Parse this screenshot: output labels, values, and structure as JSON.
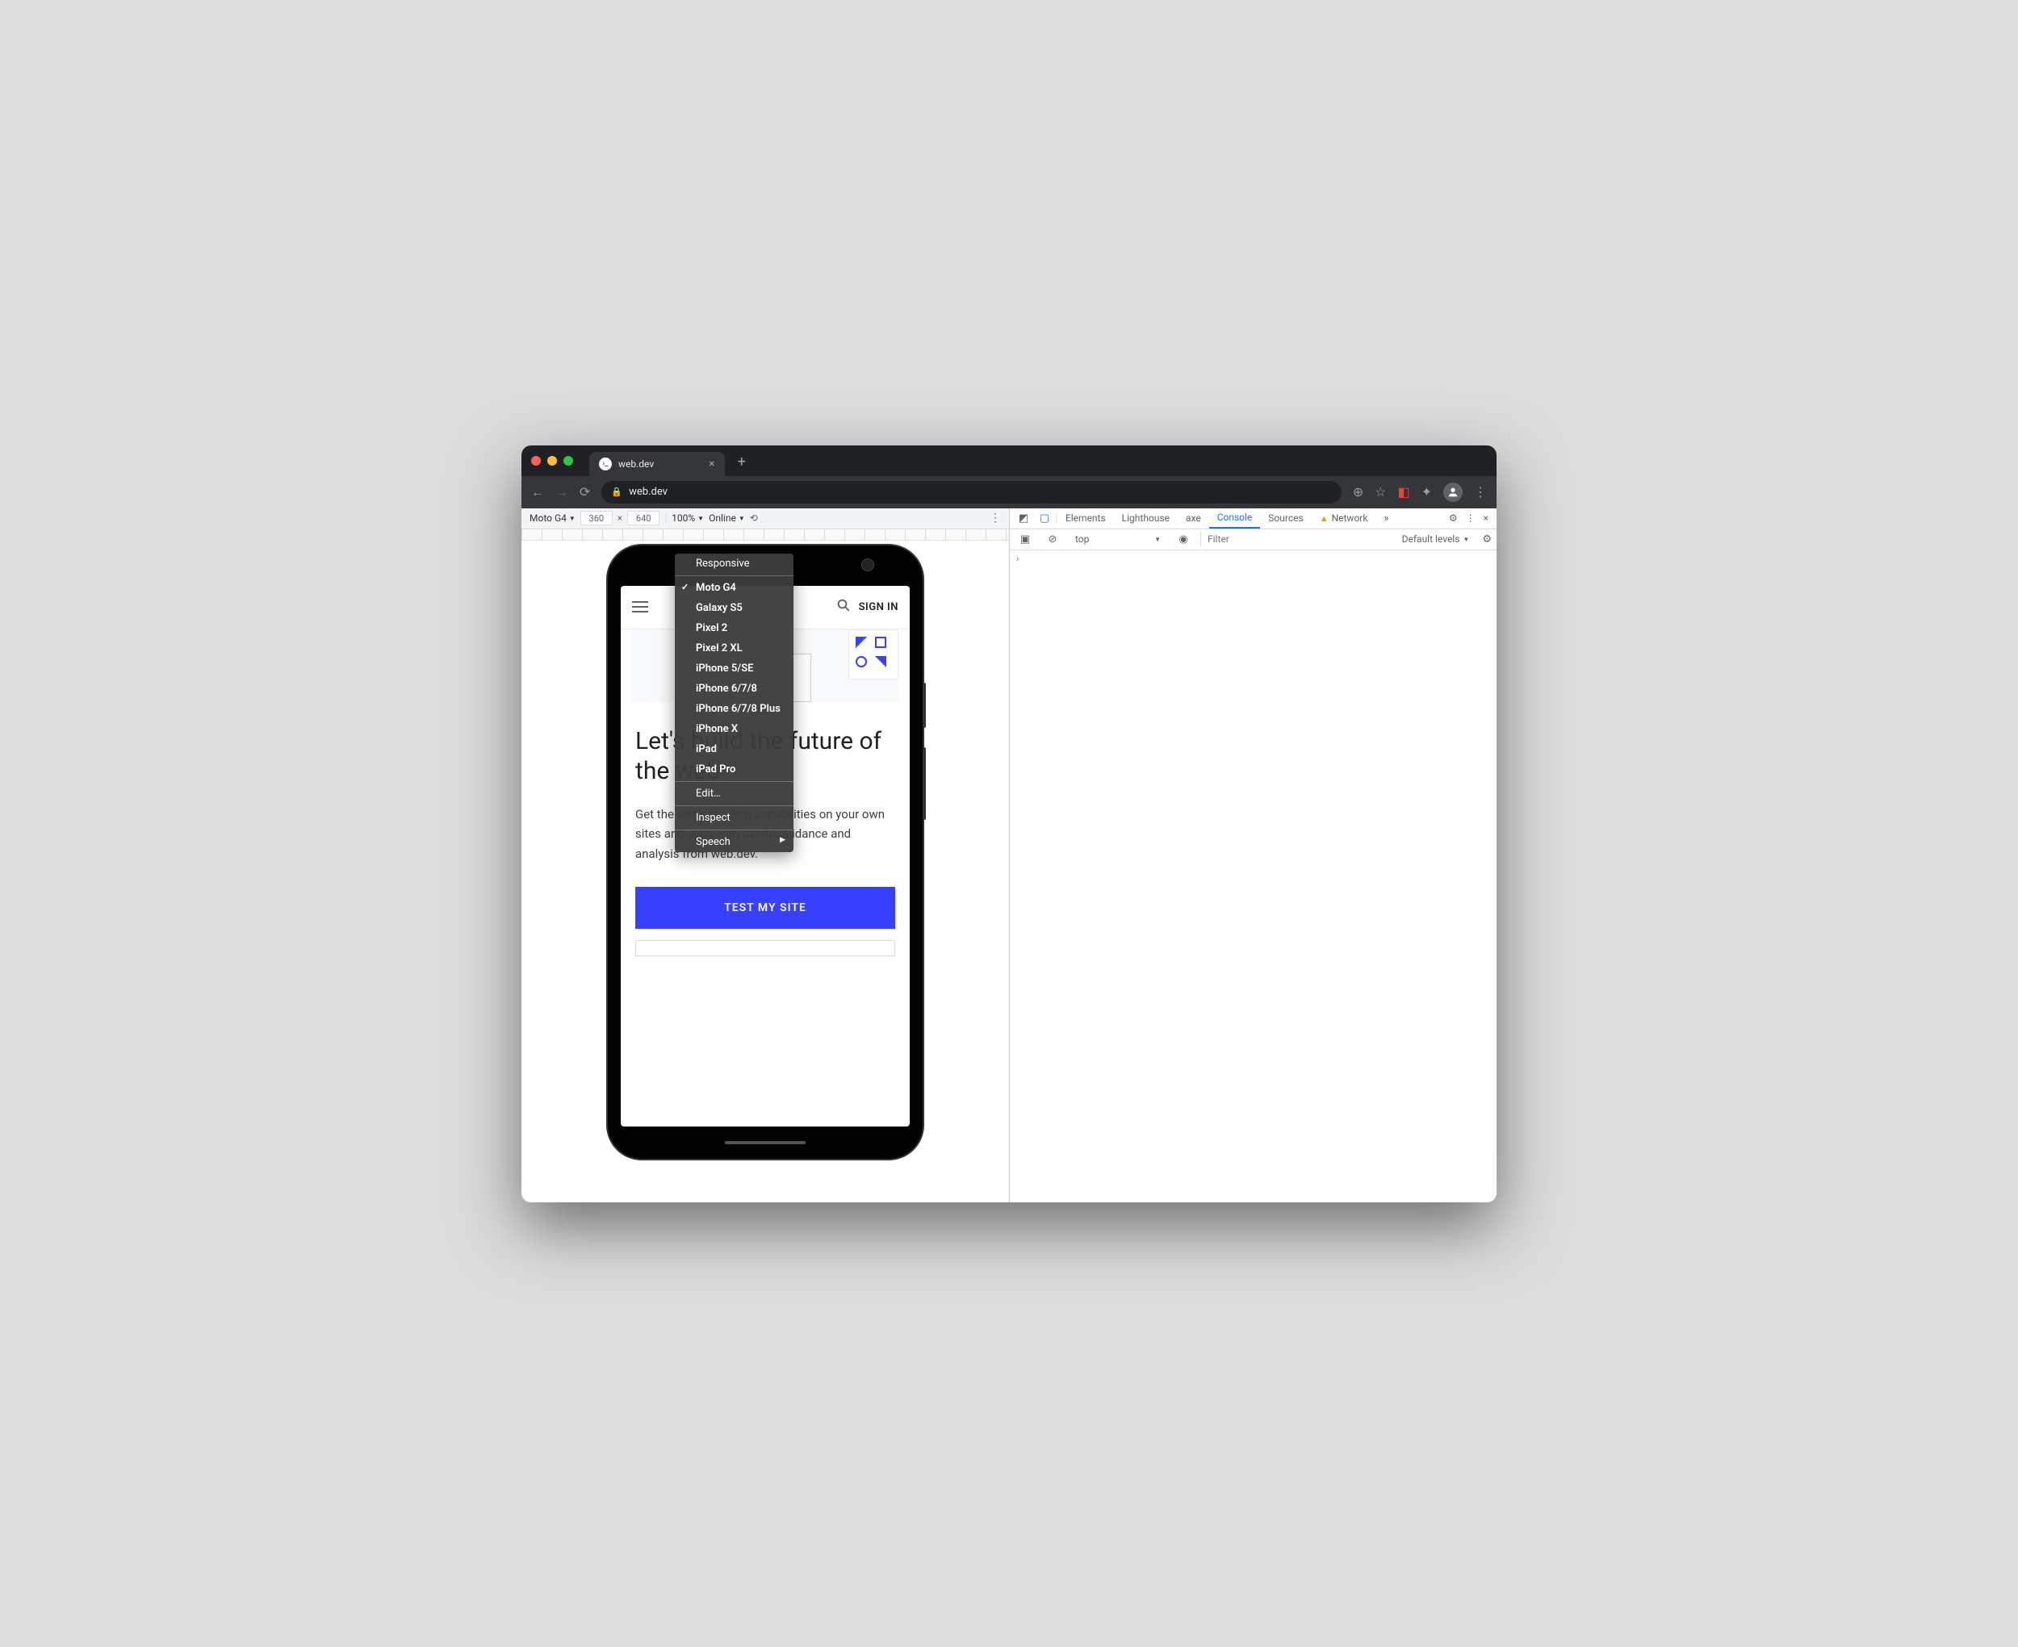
{
  "browser": {
    "tab_title": "web.dev",
    "url": "web.dev"
  },
  "device_toolbar": {
    "device": "Moto G4",
    "width": "360",
    "height": "640",
    "separator": "×",
    "zoom": "100%",
    "throttle": "Online"
  },
  "context_menu": {
    "responsive": "Responsive",
    "devices": [
      "Moto G4",
      "Galaxy S5",
      "Pixel 2",
      "Pixel 2 XL",
      "iPhone 5/SE",
      "iPhone 6/7/8",
      "iPhone 6/7/8 Plus",
      "iPhone X",
      "iPad",
      "iPad Pro"
    ],
    "selected": "Moto G4",
    "edit": "Edit…",
    "inspect": "Inspect",
    "speech": "Speech"
  },
  "site": {
    "sign_in": "SIGN IN",
    "hero_title": "Let's build the future of the web",
    "hero_body": "Get the web's modern capabilities on your own sites and apps with useful guidance and analysis from web.dev.",
    "cta": "TEST MY SITE"
  },
  "devtools": {
    "tabs": {
      "elements": "Elements",
      "lighthouse": "Lighthouse",
      "axe": "axe",
      "console": "Console",
      "sources": "Sources",
      "network": "Network"
    },
    "console": {
      "context": "top",
      "filter_placeholder": "Filter",
      "levels": "Default levels",
      "prompt": "›"
    }
  }
}
